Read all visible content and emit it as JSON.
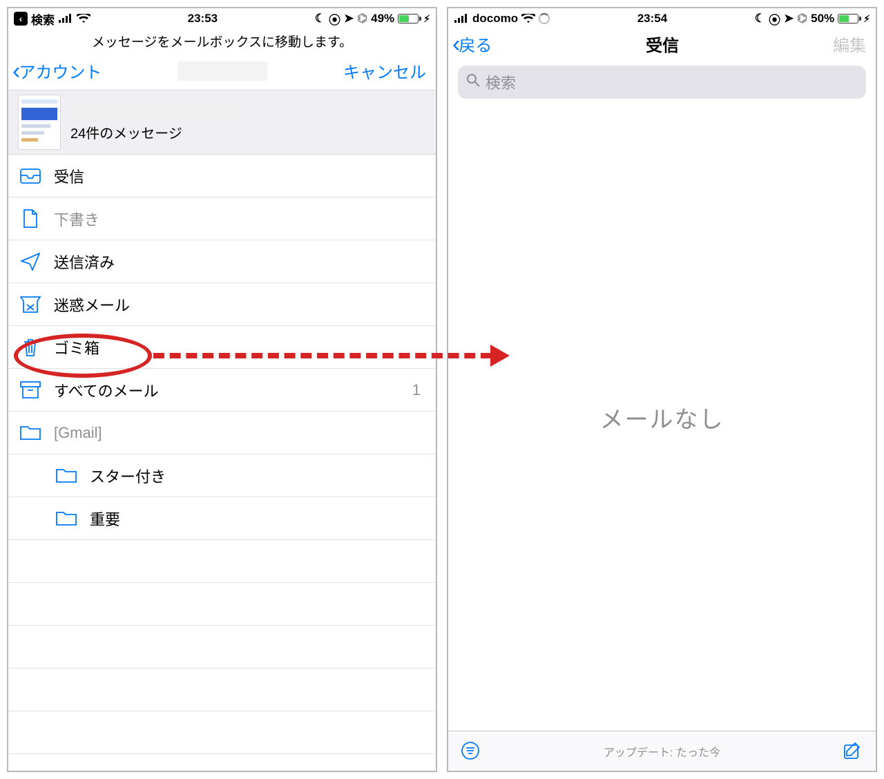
{
  "left": {
    "status": {
      "back_to_app": "検索",
      "time": "23:53",
      "battery_pct": "49%"
    },
    "subtitle": "メッセージをメールボックスに移動します。",
    "nav": {
      "back": "アカウント",
      "right": "キャンセル"
    },
    "selection": {
      "count_label": "24件のメッセージ"
    },
    "rows": {
      "inbox": "受信",
      "drafts": "下書き",
      "sent": "送信済み",
      "junk": "迷惑メール",
      "trash": "ゴミ箱",
      "allmail": "すべてのメール",
      "allmail_count": "1",
      "gmail": "[Gmail]",
      "starred": "スター付き",
      "important": "重要"
    }
  },
  "right": {
    "status": {
      "carrier": "docomo",
      "time": "23:54",
      "battery_pct": "50%"
    },
    "nav": {
      "back": "戻る",
      "title": "受信",
      "right": "編集"
    },
    "search_placeholder": "検索",
    "empty": "メールなし",
    "toolbar": {
      "status": "アップデート: たった今"
    }
  },
  "colors": {
    "ios_blue": "#007aff",
    "annotation_red": "#d62424"
  }
}
